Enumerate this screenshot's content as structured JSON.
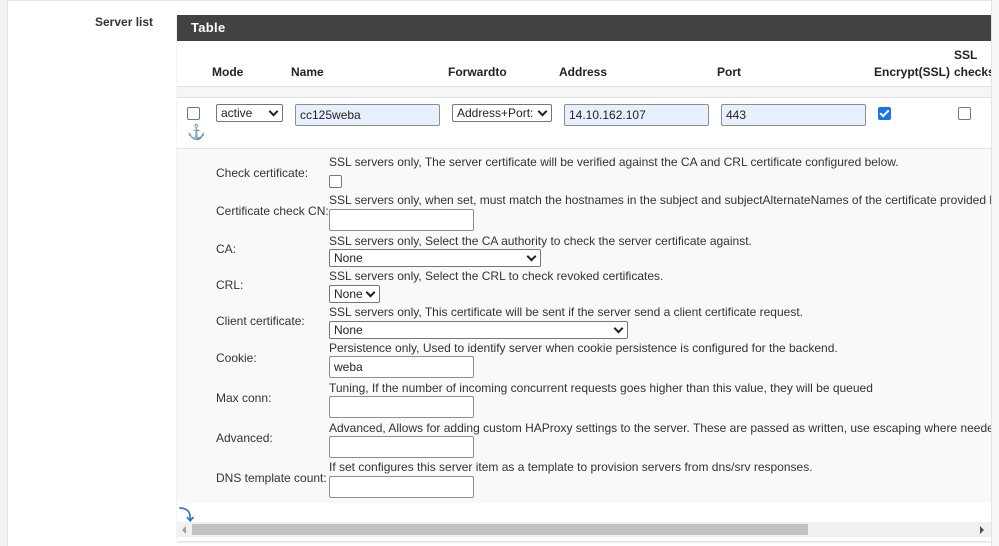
{
  "section": {
    "label": "Server list"
  },
  "panel": {
    "title": "Table"
  },
  "table": {
    "columns": {
      "mode": "Mode",
      "name": "Name",
      "forwardto": "Forwardto",
      "address": "Address",
      "port": "Port",
      "encrypt": "Encrypt(SSL)",
      "sslchecks_line1": "SSL",
      "sslchecks_line2": "checks"
    },
    "row": {
      "selected": false,
      "mode": "active",
      "name": "cc125weba",
      "forwardto": "Address+Port:",
      "address": "14.10.162.107",
      "port": "443",
      "encrypt_ssl": true,
      "ssl_checks": false
    }
  },
  "icons": {
    "anchor": "⚓",
    "bottom": "⤵"
  },
  "details": {
    "check_certificate": {
      "label": "Check certificate:",
      "help": "SSL servers only, The server certificate will be verified against the CA and CRL certificate configured below.",
      "checked": false
    },
    "certificate_check_cn": {
      "label": "Certificate check CN:",
      "help": "SSL servers only, when set, must match the hostnames in the subject and subjectAlternateNames of the certificate provided by the server",
      "value": ""
    },
    "ca": {
      "label": "CA:",
      "help": "SSL servers only, Select the CA authority to check the server certificate against.",
      "value": "None"
    },
    "crl": {
      "label": "CRL:",
      "help": "SSL servers only, Select the CRL to check revoked certificates.",
      "value": "None"
    },
    "client_certificate": {
      "label": "Client certificate:",
      "help": "SSL servers only, This certificate will be sent if the server send a client certificate request.",
      "value": "None"
    },
    "cookie": {
      "label": "Cookie:",
      "help": "Persistence only, Used to identify server when cookie persistence is configured for the backend.",
      "value": "weba"
    },
    "max_conn": {
      "label": "Max conn:",
      "help": "Tuning, If the number of incoming concurrent requests goes higher than this value, they will be queued",
      "value": ""
    },
    "advanced": {
      "label": "Advanced:",
      "help": "Advanced, Allows for adding custom HAProxy settings to the server. These are passed as written, use escaping where needed.",
      "value": ""
    },
    "dns_template_count": {
      "label": "DNS template count:",
      "help": "If set configures this server item as a template to provision servers from dns/srv responses.",
      "value": ""
    }
  },
  "colors": {
    "header_bg": "#424242",
    "accent": "#2a74bf",
    "checkbox_checked": "#1a73e8",
    "input_filled": "#e8f0fe"
  }
}
